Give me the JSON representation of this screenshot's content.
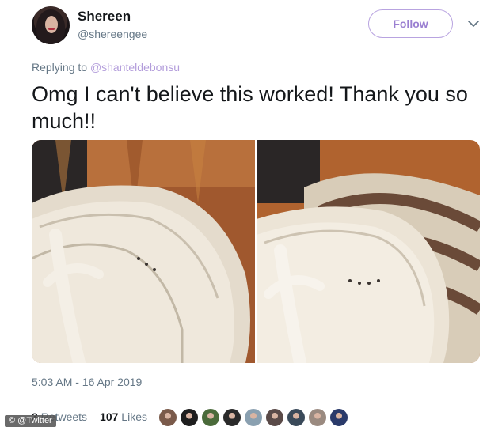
{
  "user": {
    "display_name": "Shereen",
    "handle": "@shereengee"
  },
  "header": {
    "follow_label": "Follow"
  },
  "reply": {
    "prefix": "Replying to",
    "mention": "@shanteldebonsu"
  },
  "tweet": {
    "text": "Omg I can't believe this worked! Thank you so much!!",
    "timestamp": "5:03 AM - 16 Apr 2019"
  },
  "stats": {
    "retweets_count": "3",
    "retweets_label": "Retweets",
    "likes_count": "107",
    "likes_label": "Likes"
  },
  "watermark": "© @Twitter",
  "likers": [
    {
      "color": "#7a5a4a"
    },
    {
      "color": "#1e1e1e"
    },
    {
      "color": "#4a6a3a"
    },
    {
      "color": "#2a2a2a"
    },
    {
      "color": "#8aa0b0"
    },
    {
      "color": "#5a4a48"
    },
    {
      "color": "#3a4a5a"
    },
    {
      "color": "#9a8a80"
    },
    {
      "color": "#2a3a6a"
    }
  ],
  "colors": {
    "accent": "#b39ddb",
    "text": "#14171a",
    "secondary": "#657786"
  }
}
